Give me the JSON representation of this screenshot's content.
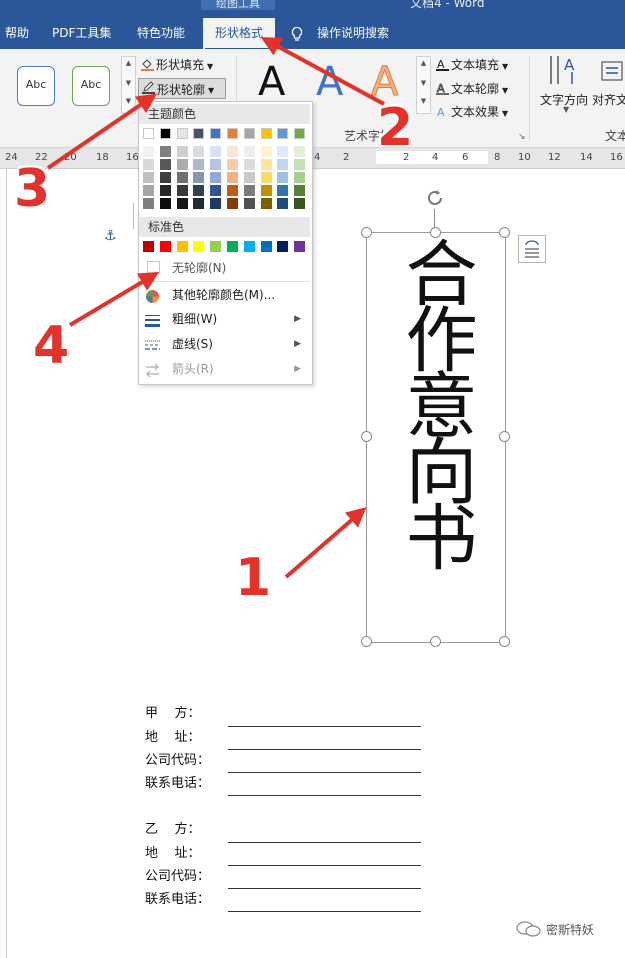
{
  "window": {
    "context_label": "绘图工具",
    "doc_title": "文档4  -  Word"
  },
  "tabs": [
    {
      "label": "帮助"
    },
    {
      "label": "PDF工具集"
    },
    {
      "label": "特色功能"
    },
    {
      "label": "形状格式",
      "active": true
    },
    {
      "label": "操作说明搜索"
    }
  ],
  "ribbon": {
    "shape_styles": [
      "Abc",
      "Abc"
    ],
    "shape_fill": "形状填充",
    "shape_outline": "形状轮廓",
    "wordart_letters": [
      "A",
      "A",
      "A"
    ],
    "wordart_group_label": "艺术字样",
    "text_fill": "文本填充",
    "text_outline": "文本轮廓",
    "text_effects": "文本效果",
    "text_direction": "文字方向",
    "align_text": "对齐文",
    "text_group_label": "文本"
  },
  "ruler": {
    "left_ticks": [
      "24",
      "22",
      "20",
      "18",
      "16"
    ],
    "mid_ticks": [
      "4",
      "2"
    ],
    "white_ticks": [
      "2",
      "4",
      "6"
    ],
    "right_ticks": [
      "8",
      "10",
      "12",
      "14",
      "16"
    ]
  },
  "dropdown": {
    "theme_colors_header": "主题颜色",
    "standard_colors_header": "标准色",
    "theme_top_row": [
      "#ffffff",
      "#000000",
      "#e7e6e6",
      "#44546a",
      "#4472c4",
      "#ed7d31",
      "#a5a5a5",
      "#ffc000",
      "#5b9bd5",
      "#70ad47"
    ],
    "theme_shades": [
      [
        "#f2f2f2",
        "#7f7f7f",
        "#d0cece",
        "#d6dce4",
        "#d9e2f3",
        "#fbe5d5",
        "#ededed",
        "#fff2cc",
        "#deebf6",
        "#e2efd9"
      ],
      [
        "#d8d8d8",
        "#595959",
        "#aeabab",
        "#adb9ca",
        "#b4c6e7",
        "#f7cbac",
        "#dbdbdb",
        "#fee599",
        "#bdd7ee",
        "#c5e0b3"
      ],
      [
        "#bfbfbf",
        "#3f3f3f",
        "#757070",
        "#8496b0",
        "#8eaadb",
        "#f4b183",
        "#c9c9c9",
        "#ffd965",
        "#9cc3e5",
        "#a8d08d"
      ],
      [
        "#a5a5a5",
        "#262626",
        "#3a3838",
        "#323f4f",
        "#2f5496",
        "#c55a11",
        "#7b7b7b",
        "#bf8f00",
        "#2e75b5",
        "#538135"
      ],
      [
        "#7f7f7f",
        "#0c0c0c",
        "#171616",
        "#222a35",
        "#1f3864",
        "#833c0b",
        "#525252",
        "#7f6000",
        "#1e4e79",
        "#375623"
      ]
    ],
    "standard_colors": [
      "#c00000",
      "#ff0000",
      "#ffc000",
      "#ffff00",
      "#92d050",
      "#00b050",
      "#00b0f0",
      "#0070c0",
      "#002060",
      "#7030a0"
    ],
    "no_outline": "无轮廓(N)",
    "more_colors": "其他轮廓颜色(M)...",
    "weight": "粗细(W)",
    "dashes": "虚线(S)",
    "arrows": "箭头(R)"
  },
  "document": {
    "shape_text": "合作意向书",
    "party_a": [
      {
        "label": "甲    方："
      },
      {
        "label": "地    址："
      },
      {
        "label": "公司代码："
      },
      {
        "label": "联系电话："
      }
    ],
    "party_b": [
      {
        "label": "乙    方："
      },
      {
        "label": "地    址："
      },
      {
        "label": "公司代码："
      },
      {
        "label": "联系电话："
      }
    ]
  },
  "annotations": [
    "1",
    "2",
    "3",
    "4"
  ],
  "annotation_color": "#e4322b",
  "watermark": "密斯特妖"
}
